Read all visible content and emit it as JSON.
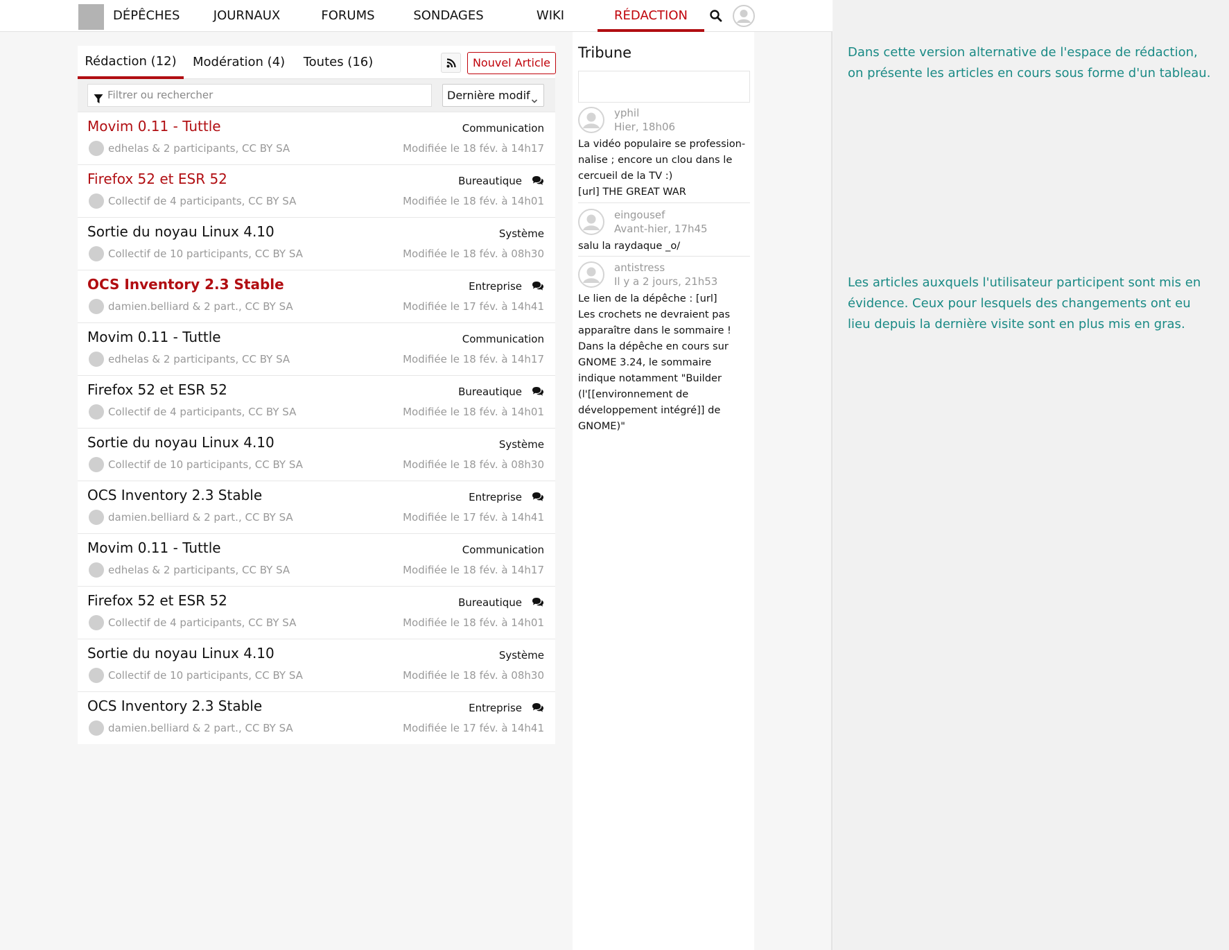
{
  "nav": {
    "items": [
      {
        "label": "DÉPÊCHES"
      },
      {
        "label": "JOURNAUX"
      },
      {
        "label": "FORUMS"
      },
      {
        "label": "SONDAGES"
      },
      {
        "label": "WIKI"
      },
      {
        "label": "RÉDACTION",
        "active": true
      }
    ],
    "search_icon": "search-icon",
    "user_icon": "user-avatar-icon"
  },
  "tabs": [
    {
      "label": "Rédaction (12)",
      "active": true
    },
    {
      "label": "Modération (4)"
    },
    {
      "label": "Toutes (16)"
    }
  ],
  "rss_icon": "rss-icon",
  "new_article_label": "Nouvel Article",
  "filter": {
    "placeholder": "Filtrer ou rechercher",
    "icon": "filter-icon"
  },
  "sort": {
    "selected": "Dernière modif"
  },
  "articles": [
    {
      "title": "Movim 0.11 - Tuttle",
      "category": "Communication",
      "authors": "edhelas & 2 participants, CC BY SA",
      "modified": "Modifiée le 18 fév. à 14h17",
      "highlighted": true,
      "bold": false,
      "has_comments": false
    },
    {
      "title": "Firefox 52 et ESR 52",
      "category": "Bureautique",
      "authors": "Collectif de 4 participants, CC BY SA",
      "modified": "Modifiée le 18 fév. à 14h01",
      "highlighted": true,
      "bold": false,
      "has_comments": true
    },
    {
      "title": "Sortie du noyau Linux 4.10",
      "category": "Système",
      "authors": "Collectif de 10 participants, CC BY SA",
      "modified": "Modifiée le 18 fév. à 08h30",
      "highlighted": false,
      "bold": false,
      "has_comments": false
    },
    {
      "title": "OCS Inventory 2.3 Stable",
      "category": "Entreprise",
      "authors": "damien.belliard & 2 part., CC BY SA",
      "modified": "Modifiée le 17 fév. à 14h41",
      "highlighted": true,
      "bold": true,
      "has_comments": true
    },
    {
      "title": "Movim 0.11 - Tuttle",
      "category": "Communication",
      "authors": "edhelas & 2 participants, CC BY SA",
      "modified": "Modifiée le 18 fév. à 14h17",
      "highlighted": false,
      "bold": false,
      "has_comments": false
    },
    {
      "title": "Firefox 52 et ESR 52",
      "category": "Bureautique",
      "authors": "Collectif de 4 participants, CC BY SA",
      "modified": "Modifiée le 18 fév. à 14h01",
      "highlighted": false,
      "bold": false,
      "has_comments": true
    },
    {
      "title": "Sortie du noyau Linux 4.10",
      "category": "Système",
      "authors": "Collectif de 10 participants, CC BY SA",
      "modified": "Modifiée le 18 fév. à 08h30",
      "highlighted": false,
      "bold": false,
      "has_comments": false
    },
    {
      "title": "OCS Inventory 2.3 Stable",
      "category": "Entreprise",
      "authors": "damien.belliard & 2 part., CC BY SA",
      "modified": "Modifiée le 17 fév. à 14h41",
      "highlighted": false,
      "bold": false,
      "has_comments": true
    },
    {
      "title": "Movim 0.11 - Tuttle",
      "category": "Communication",
      "authors": "edhelas & 2 participants, CC BY SA",
      "modified": "Modifiée le 18 fév. à 14h17",
      "highlighted": false,
      "bold": false,
      "has_comments": false
    },
    {
      "title": "Firefox 52 et ESR 52",
      "category": "Bureautique",
      "authors": "Collectif de 4 participants, CC BY SA",
      "modified": "Modifiée le 18 fév. à 14h01",
      "highlighted": false,
      "bold": false,
      "has_comments": true
    },
    {
      "title": "Sortie du noyau Linux 4.10",
      "category": "Système",
      "authors": "Collectif de 10 participants, CC BY SA",
      "modified": "Modifiée le 18 fév. à 08h30",
      "highlighted": false,
      "bold": false,
      "has_comments": false
    },
    {
      "title": "OCS Inventory 2.3 Stable",
      "category": "Entreprise",
      "authors": "damien.belliard & 2 part., CC BY SA",
      "modified": "Modifiée le 17 fév. à 14h41",
      "highlighted": false,
      "bold": false,
      "has_comments": true
    }
  ],
  "tribune": {
    "title": "Tribune",
    "messages": [
      {
        "user": "yphil",
        "time": "Hier, 18h06",
        "text": "La vidéo populaire se profession-\nnalise ; encore un clou dans le\ncercueil de la TV :)\n[url] THE GREAT WAR"
      },
      {
        "user": "eingousef",
        "time": "Avant-hier, 17h45",
        "text": "salu la raydaque _o/"
      },
      {
        "user": "antistress",
        "time": "Il y a 2 jours, 21h53",
        "text": "Le lien de la dépêche : [url]\nLes crochets ne devraient pas\napparaître dans le sommaire !\nDans la dépêche en cours sur\nGNOME 3.24, le sommaire\nindique notamment \"Builder\n(l'[[environnement de\ndéveloppement intégré]] de\nGNOME)\""
      }
    ]
  },
  "notes": [
    "Dans cette version alternative de l'espace de rédaction, on présente les articles en cours sous forme d'un tableau.",
    "Les articles auxquels l'utilisateur participent sont mis en évidence. Ceux pour lesquels des changements ont eu lieu depuis la dernière visite sont en plus mis en gras."
  ],
  "colors": {
    "accent": "#b10e12",
    "note": "#1a8a85",
    "meta": "#999999"
  }
}
